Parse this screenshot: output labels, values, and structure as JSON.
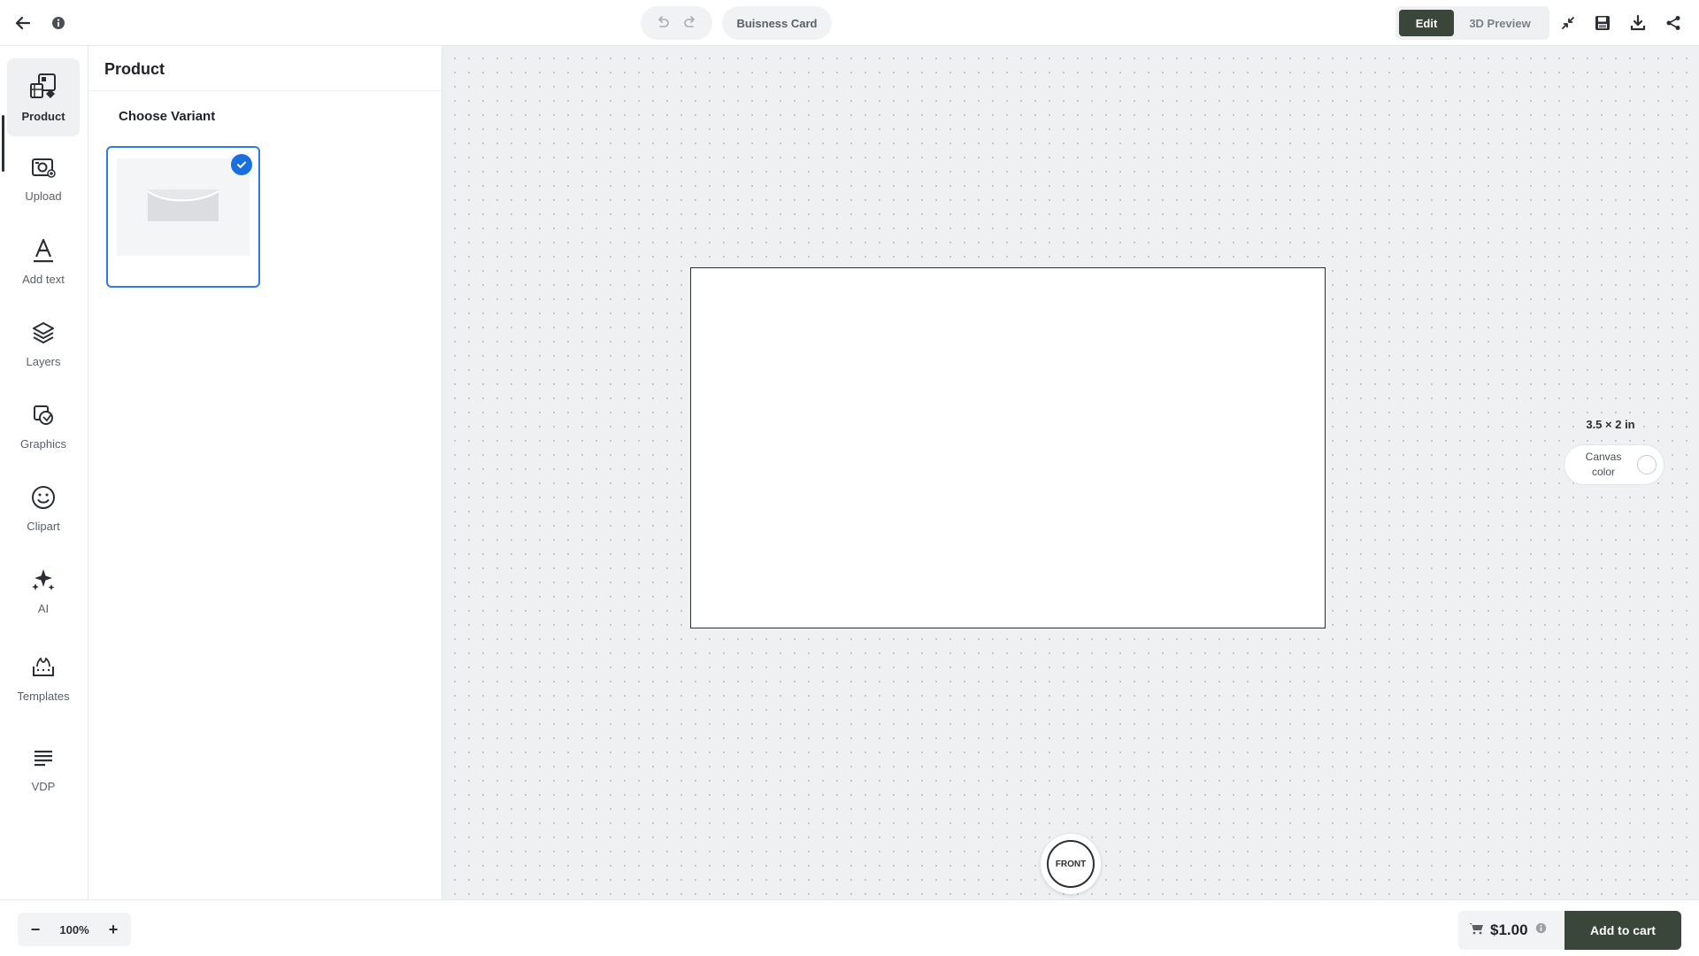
{
  "header": {
    "document_title": "Buisness Card",
    "modes": {
      "edit": "Edit",
      "preview": "3D Preview"
    },
    "icons": {
      "back": "back-arrow-icon",
      "info": "info-icon",
      "undo": "undo-icon",
      "redo": "redo-icon",
      "collapse": "collapse-icon",
      "save": "save-icon",
      "download": "download-icon",
      "share": "share-icon"
    }
  },
  "sidebar": {
    "items": [
      {
        "label": "Product",
        "icon": "product-icon",
        "active": true
      },
      {
        "label": "Upload",
        "icon": "upload-icon",
        "active": false
      },
      {
        "label": "Add text",
        "icon": "text-icon",
        "active": false
      },
      {
        "label": "Layers",
        "icon": "layers-icon",
        "active": false
      },
      {
        "label": "Graphics",
        "icon": "graphics-icon",
        "active": false
      },
      {
        "label": "Clipart",
        "icon": "clipart-icon",
        "active": false
      },
      {
        "label": "AI",
        "icon": "ai-sparkle-icon",
        "active": false
      },
      {
        "label": "Templates",
        "icon": "templates-icon",
        "active": false
      },
      {
        "label": "VDP",
        "icon": "vdp-icon",
        "active": false
      }
    ]
  },
  "panel": {
    "title": "Product",
    "section_title": "Choose Variant",
    "variants": [
      {
        "selected": true
      }
    ]
  },
  "canvas": {
    "size": "3.5 × 2 in",
    "color_label": "Canvas color",
    "color_value": "#ffffff",
    "side": "FRONT"
  },
  "footer": {
    "zoom": "100%",
    "zoom_out": "−",
    "zoom_in": "+",
    "price": "$1.00",
    "add_to_cart": "Add to cart"
  },
  "colors": {
    "primary": "#3a4639",
    "selection": "#1a6fe0",
    "workspace_bg": "#eef0f2"
  }
}
